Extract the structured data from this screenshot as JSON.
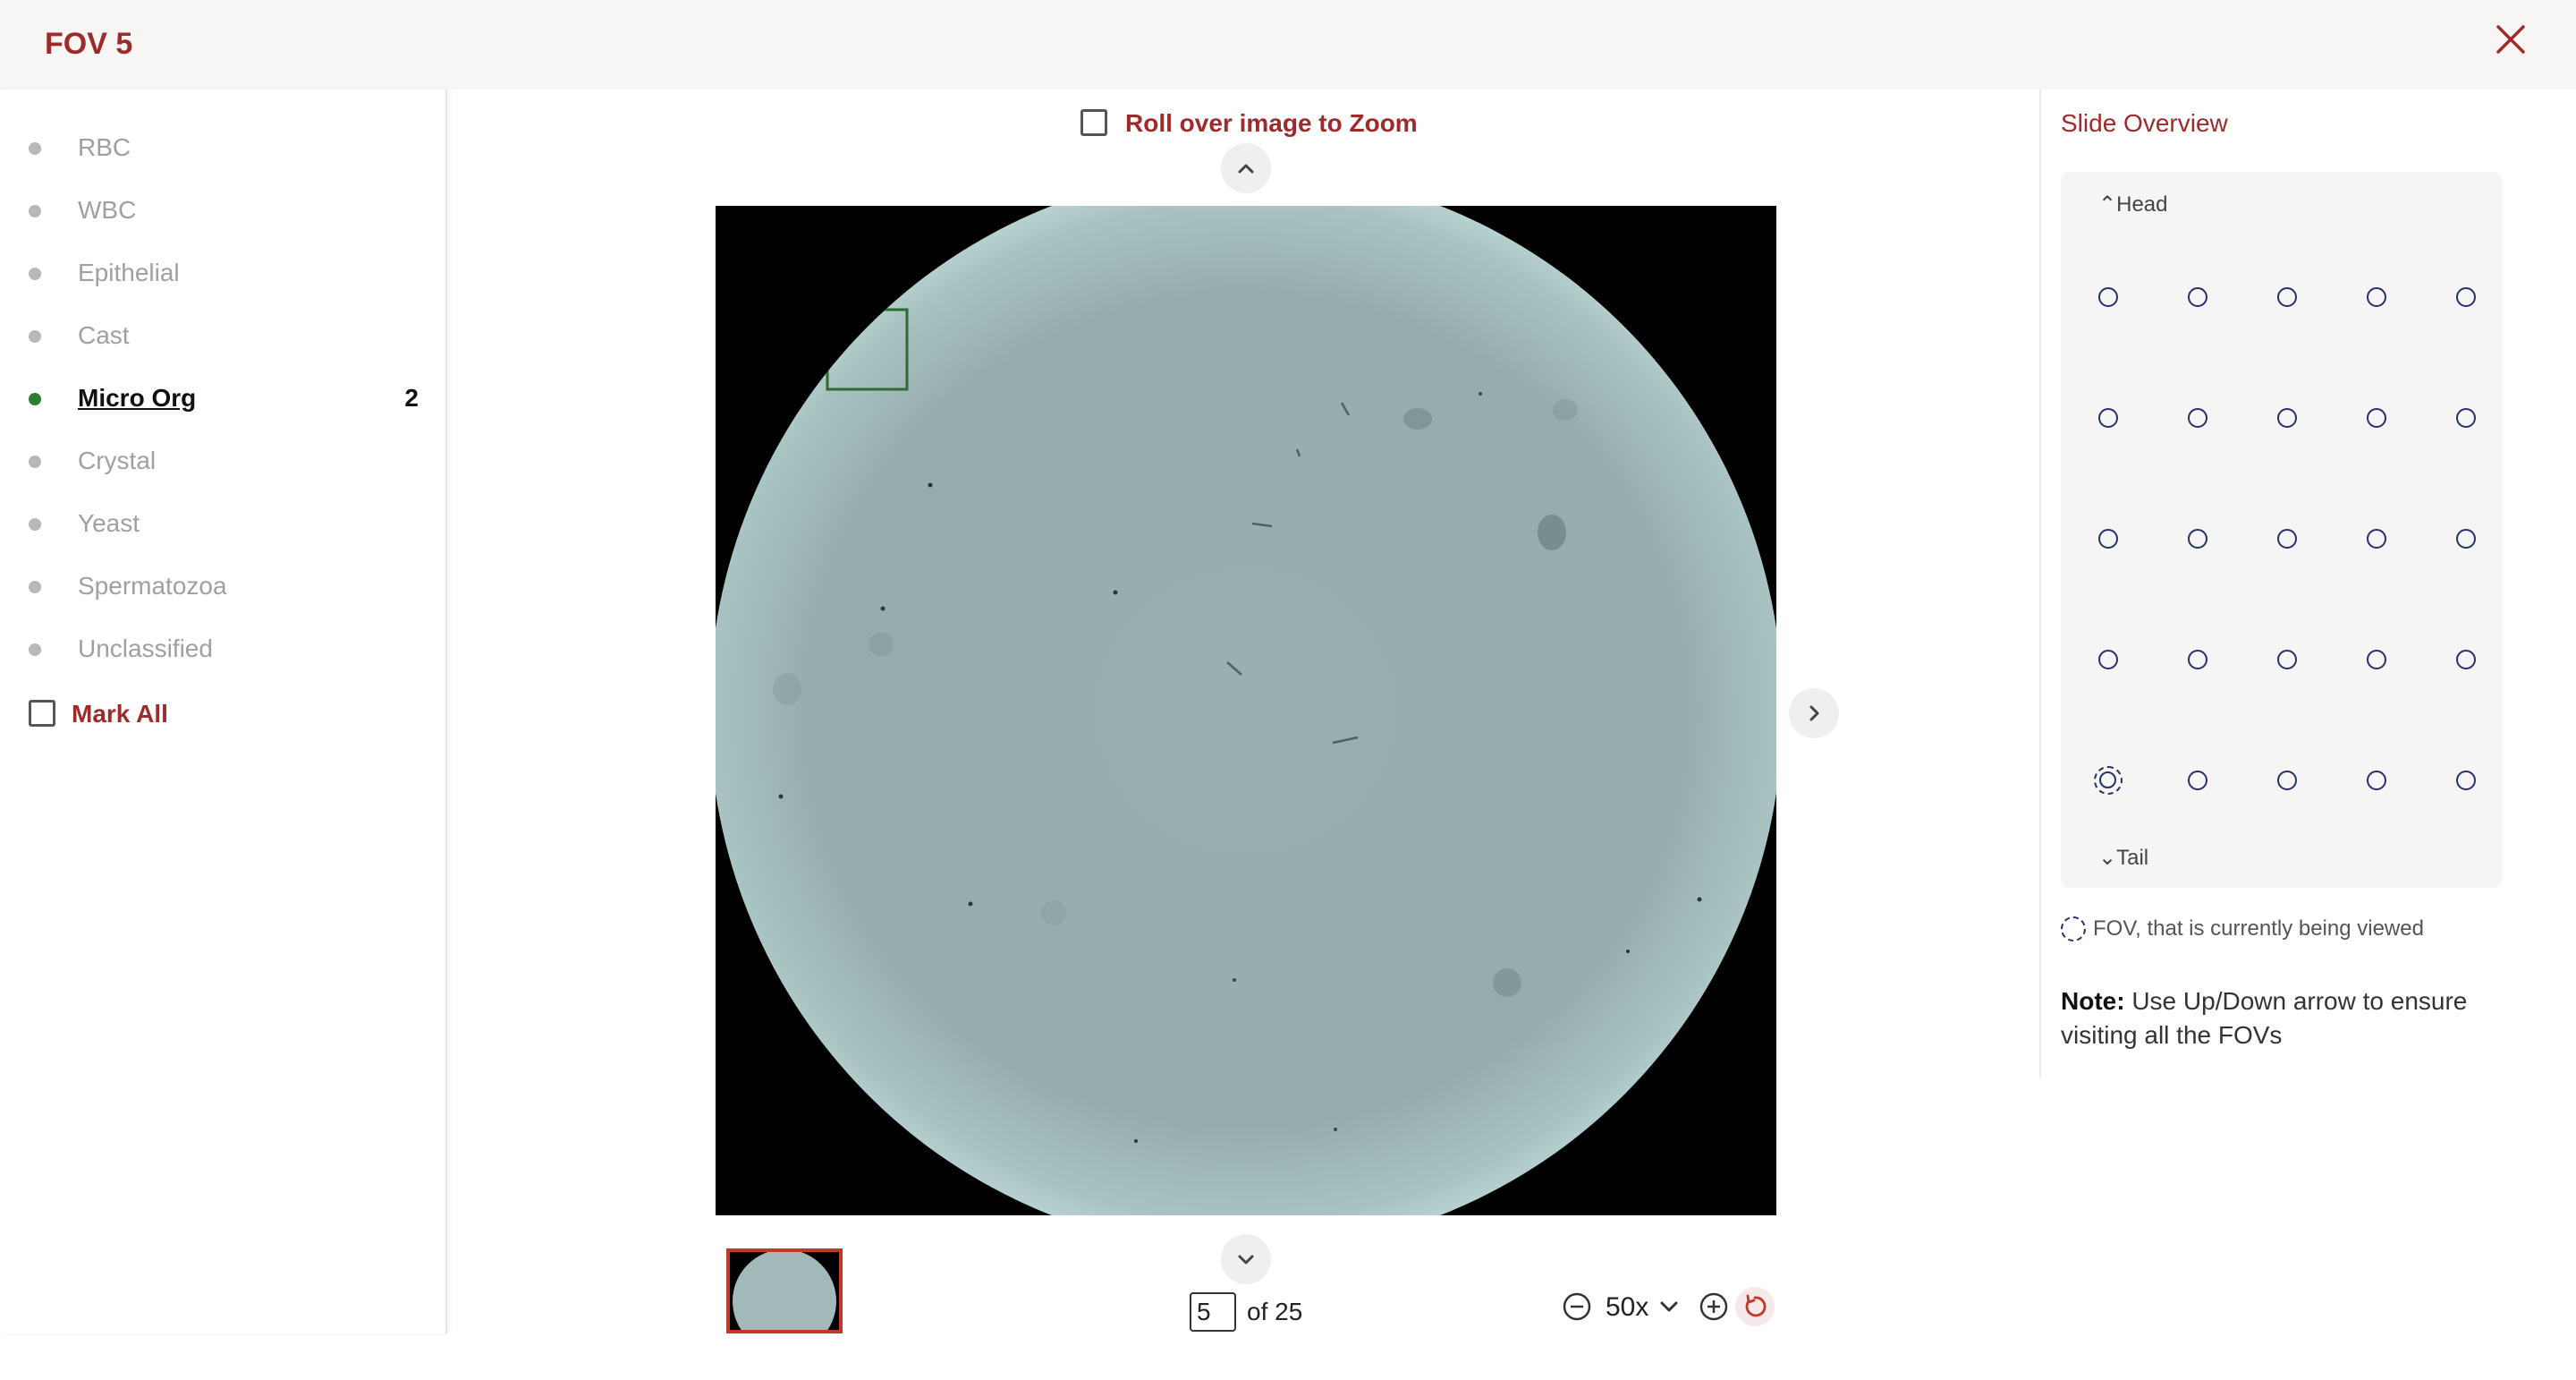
{
  "header": {
    "title": "FOV 5"
  },
  "categories": [
    {
      "label": "RBC",
      "count": "",
      "active": false
    },
    {
      "label": "WBC",
      "count": "",
      "active": false
    },
    {
      "label": "Epithelial",
      "count": "",
      "active": false
    },
    {
      "label": "Cast",
      "count": "",
      "active": false
    },
    {
      "label": "Micro Org",
      "count": "2",
      "active": true
    },
    {
      "label": "Crystal",
      "count": "",
      "active": false
    },
    {
      "label": "Yeast",
      "count": "",
      "active": false
    },
    {
      "label": "Spermatozoa",
      "count": "",
      "active": false
    },
    {
      "label": "Unclassified",
      "count": "",
      "active": false
    }
  ],
  "mark_all": {
    "label": "Mark All",
    "checked": false
  },
  "viewer": {
    "zoom_toggle_label": "Roll over image to Zoom",
    "zoom_toggle_checked": false,
    "current_page": "5",
    "of_text": "of 25",
    "zoom_level": "50x"
  },
  "overview": {
    "title": "Slide Overview",
    "head_label": "Head",
    "tail_label": "Tail",
    "rows": 5,
    "cols": 5,
    "current_row": 5,
    "current_col": 1,
    "legend_text": "FOV, that is currently being viewed",
    "note_bold": "Note:",
    "note_text": " Use Up/Down arrow to ensure visiting all the FOVs"
  },
  "colors": {
    "accent": "#9e2b2b",
    "active_dot": "#2e7d32",
    "inactive_text": "#a0a0a0",
    "overview_dot": "#2a2f6b",
    "image_tint": "#97aeae"
  },
  "icons": {
    "close": "close-icon",
    "up": "chevron-up-icon",
    "down": "chevron-down-icon",
    "next": "chevron-right-icon",
    "zoom_out": "zoom-out-icon",
    "zoom_in": "zoom-in-icon",
    "reset": "reset-icon"
  }
}
